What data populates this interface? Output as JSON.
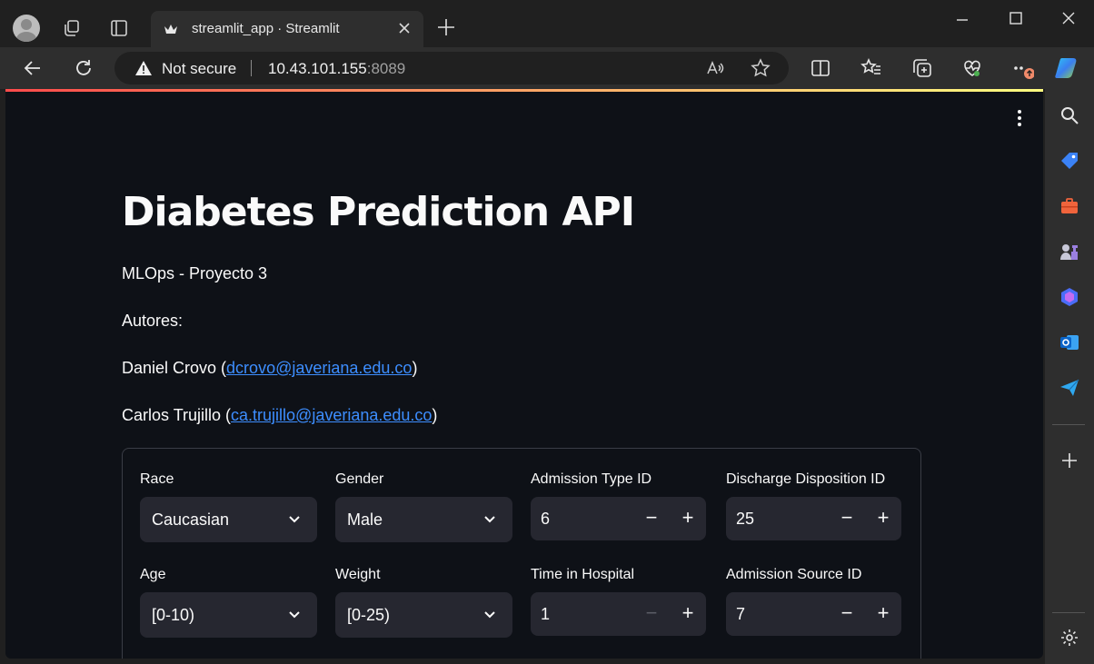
{
  "browser": {
    "tab_title": "streamlit_app · Streamlit",
    "security_label": "Not secure",
    "url_host": "10.43.101.155",
    "url_port": ":8089"
  },
  "page": {
    "title": "Diabetes Prediction API",
    "subtitle": "MLOps - Proyecto 3",
    "authors_label": "Autores:",
    "authors": [
      {
        "name": "Daniel Crovo",
        "email": "dcrovo@javeriana.edu.co"
      },
      {
        "name": "Carlos Trujillo",
        "email": "ca.trujillo@javeriana.edu.co"
      }
    ]
  },
  "form": {
    "race": {
      "label": "Race",
      "value": "Caucasian"
    },
    "gender": {
      "label": "Gender",
      "value": "Male"
    },
    "admission_type_id": {
      "label": "Admission Type ID",
      "value": "6"
    },
    "discharge_disposition_id": {
      "label": "Discharge Disposition ID",
      "value": "25"
    },
    "age": {
      "label": "Age",
      "value": "[0-10)"
    },
    "weight": {
      "label": "Weight",
      "value": "[0-25)"
    },
    "time_in_hospital": {
      "label": "Time in Hospital",
      "value": "1"
    },
    "admission_source_id": {
      "label": "Admission Source ID",
      "value": "7"
    },
    "stepper_minus": "−",
    "stepper_plus": "+"
  },
  "colors": {
    "app_background": "#0e1117",
    "widget_background": "#262730",
    "link": "#3d8eff",
    "decoration_start": "#ff4b4b",
    "decoration_end": "#fffd80"
  }
}
